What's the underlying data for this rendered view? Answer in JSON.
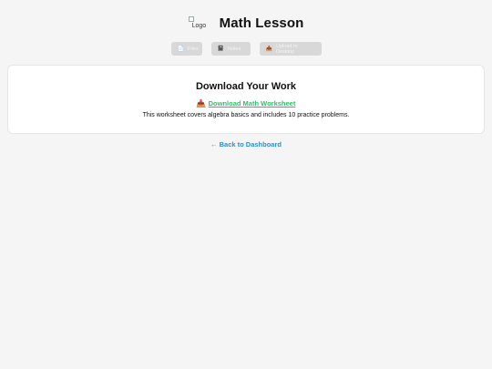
{
  "header": {
    "logo_alt": "Logo",
    "title": "Math Lesson"
  },
  "toolbar": {
    "files_label": "Files",
    "files_icon": "file-icon",
    "notes_label": "Notes",
    "notes_icon": "notebook-icon",
    "upload_label": "Upload to Desktop",
    "upload_icon": "upload-tray-icon"
  },
  "card": {
    "heading": "Download Your Work",
    "download_icon": "download-tray-icon",
    "download_label": "Download Math Worksheet",
    "description": "This worksheet covers algebra basics and includes 10 practice problems."
  },
  "back_link": {
    "label": "← Back to Dashboard"
  },
  "colors": {
    "background": "#f5f5f5",
    "download_link": "#2fbf6a",
    "back_link": "#2a8fd6",
    "disabled_button": "#d8d8d8"
  }
}
